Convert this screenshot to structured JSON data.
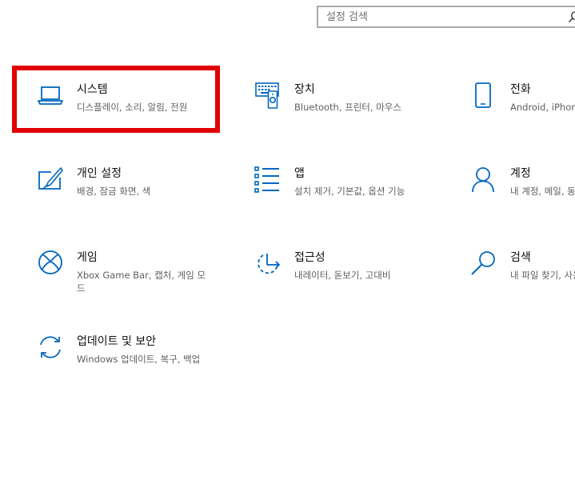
{
  "search": {
    "placeholder": "설정 검색"
  },
  "tiles": [
    {
      "title": "시스템",
      "desc": "디스플레이, 소리, 알림, 전원"
    },
    {
      "title": "장치",
      "desc": "Bluetooth, 프린터, 마우스"
    },
    {
      "title": "전화",
      "desc": "Android, iPhone 연결"
    },
    {
      "title": "개인 설정",
      "desc": "배경, 잠금 화면, 색"
    },
    {
      "title": "앱",
      "desc": "설치 제거, 기본값, 옵션 기능"
    },
    {
      "title": "계정",
      "desc": "내 계정, 메일, 동기화, 회사, 가족"
    },
    {
      "title": "게임",
      "desc": "Xbox Game Bar, 캡처, 게임 모드"
    },
    {
      "title": "접근성",
      "desc": "내레이터, 돋보기, 고대비"
    },
    {
      "title": "검색",
      "desc": "내 파일 찾기, 사용 권한"
    },
    {
      "title": "업데이트 및 보안",
      "desc": "Windows 업데이트, 복구, 백업"
    }
  ],
  "colors": {
    "accent": "#0067c0",
    "highlight": "#e00000"
  },
  "icons": [
    "laptop-icon",
    "devices-icon",
    "phone-icon",
    "personalization-icon",
    "apps-icon",
    "account-icon",
    "xbox-icon",
    "accessibility-icon",
    "search-icon",
    "update-icon"
  ]
}
